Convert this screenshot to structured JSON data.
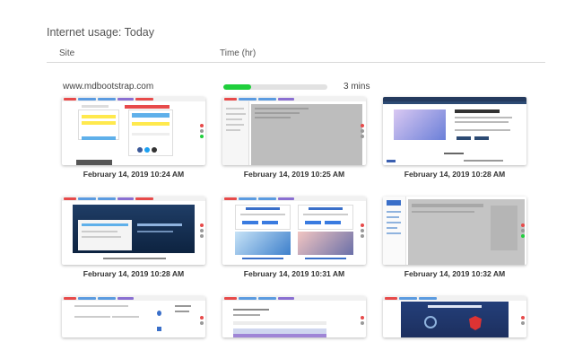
{
  "header": {
    "title": "Internet usage:  Today",
    "col_site": "Site",
    "col_time": "Time (hr)"
  },
  "entry": {
    "site": "www.mdbootstrap.com",
    "duration": "3 mins",
    "usage_fraction": 0.27,
    "bar_color": "#1fcf3c"
  },
  "screenshots": [
    {
      "caption": "February 14, 2019 10:24 AM"
    },
    {
      "caption": "February 14, 2019 10:25 AM"
    },
    {
      "caption": "February 14, 2019 10:28 AM"
    },
    {
      "caption": "February 14, 2019 10:28 AM"
    },
    {
      "caption": "February 14, 2019 10:31 AM"
    },
    {
      "caption": "February 14, 2019 10:32 AM"
    },
    {
      "caption": ""
    },
    {
      "caption": ""
    },
    {
      "caption": ""
    }
  ]
}
